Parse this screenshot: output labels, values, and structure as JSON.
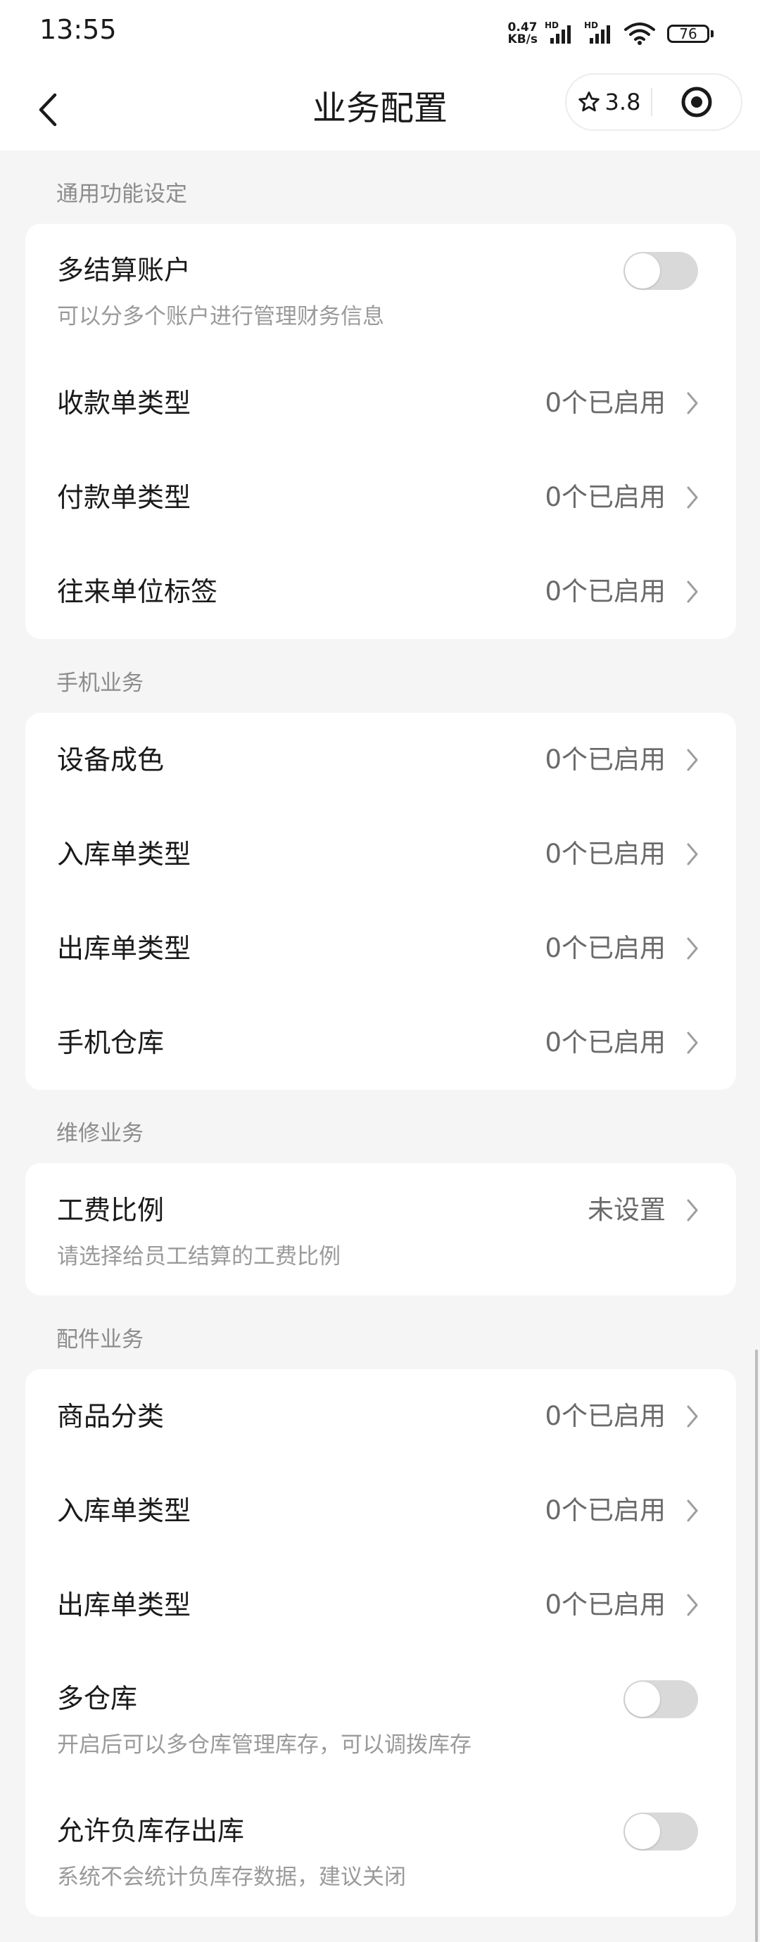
{
  "status_bar": {
    "time": "13:55",
    "net_speed_value": "0.47",
    "net_speed_unit": "KB/s",
    "signal_tag_1": "HD",
    "signal_tag_2": "HD",
    "battery_level": "76"
  },
  "nav": {
    "title": "业务配置",
    "rating": "3.8"
  },
  "sections": {
    "general": {
      "label": "通用功能设定",
      "items": [
        {
          "title": "多结算账户",
          "subtitle": "可以分多个账户进行管理财务信息",
          "toggle_on": false
        },
        {
          "title": "收款单类型",
          "value": "0个已启用"
        },
        {
          "title": "付款单类型",
          "value": "0个已启用"
        },
        {
          "title": "往来单位标签",
          "value": "0个已启用"
        }
      ]
    },
    "phone": {
      "label": "手机业务",
      "items": [
        {
          "title": "设备成色",
          "value": "0个已启用"
        },
        {
          "title": "入库单类型",
          "value": "0个已启用"
        },
        {
          "title": "出库单类型",
          "value": "0个已启用"
        },
        {
          "title": "手机仓库",
          "value": "0个已启用"
        }
      ]
    },
    "repair": {
      "label": "维修业务",
      "items": [
        {
          "title": "工费比例",
          "value": "未设置",
          "subtitle": "请选择给员工结算的工费比例"
        }
      ]
    },
    "parts": {
      "label": "配件业务",
      "items": [
        {
          "title": "商品分类",
          "value": "0个已启用"
        },
        {
          "title": "入库单类型",
          "value": "0个已启用"
        },
        {
          "title": "出库单类型",
          "value": "0个已启用"
        },
        {
          "title": "多仓库",
          "subtitle": "开启后可以多仓库管理库存，可以调拨库存",
          "toggle_on": false
        },
        {
          "title": "允许负库存出库",
          "subtitle": "系统不会统计负库存数据，建议关闭",
          "toggle_on": false
        }
      ]
    }
  },
  "colors": {
    "background": "#f5f5f5",
    "card": "#ffffff",
    "toggle_off": "#d9d9d9",
    "secondary_text": "#9a9a9a"
  },
  "icons": {
    "back": "chevron-left-icon",
    "rating": "star-outline-icon",
    "target": "target-icon",
    "row_arrow": "chevron-right-icon"
  }
}
